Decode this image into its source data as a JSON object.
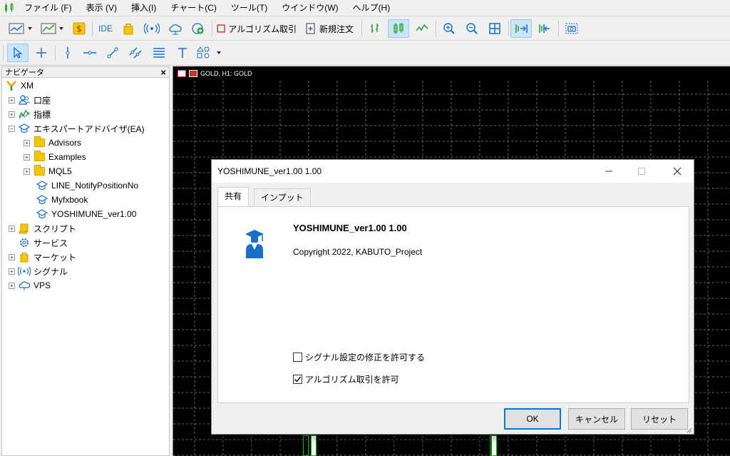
{
  "menu": {
    "items": [
      "ファイル (F)",
      "表示 (V)",
      "挿入(I)",
      "チャート(C)",
      "ツール(T)",
      "ウインドウ(W)",
      "ヘルプ(H)"
    ]
  },
  "toolbar": {
    "ide_label": "IDE",
    "algo_trading_label": "アルゴリズム取引",
    "new_order_label": "新規注文"
  },
  "navigator": {
    "title": "ナビゲータ",
    "close_glyph": "×",
    "root": "XM",
    "items": {
      "accounts": "口座",
      "indicators": "指標",
      "experts": "エキスパートアドバイザ(EA)",
      "advisors": "Advisors",
      "examples": "Examples",
      "mql5": "MQL5",
      "line_notify": "LINE_NotifyPositionNo",
      "myfxbook": "Myfxbook",
      "yoshimune": "YOSHIMUNE_ver1.00",
      "scripts": "スクリプト",
      "services": "サービス",
      "market": "マーケット",
      "signals": "シグナル",
      "vps": "VPS"
    }
  },
  "chart": {
    "label": "GOLD, H1:  GOLD"
  },
  "dialog": {
    "title": "YOSHIMUNE_ver1.00 1.00",
    "tabs": [
      "共有",
      "インプット"
    ],
    "ea_name": "YOSHIMUNE_ver1.00 1.00",
    "copyright": "Copyright 2022, KABUTO_Project",
    "checkbox_signal": {
      "label": "シグナル設定の修正を許可する",
      "checked": false
    },
    "checkbox_algo": {
      "label": "アルゴリズム取引を許可",
      "checked": true
    },
    "buttons": {
      "ok": "OK",
      "cancel": "キャンセル",
      "reset": "リセット"
    }
  },
  "colors": {
    "accent": "#0078d7",
    "ea_icon": "#1a6fc9",
    "folder": "#f7c600",
    "chart_bg": "#000000",
    "grid": "#6a6a6a",
    "candle": "#00c000"
  }
}
